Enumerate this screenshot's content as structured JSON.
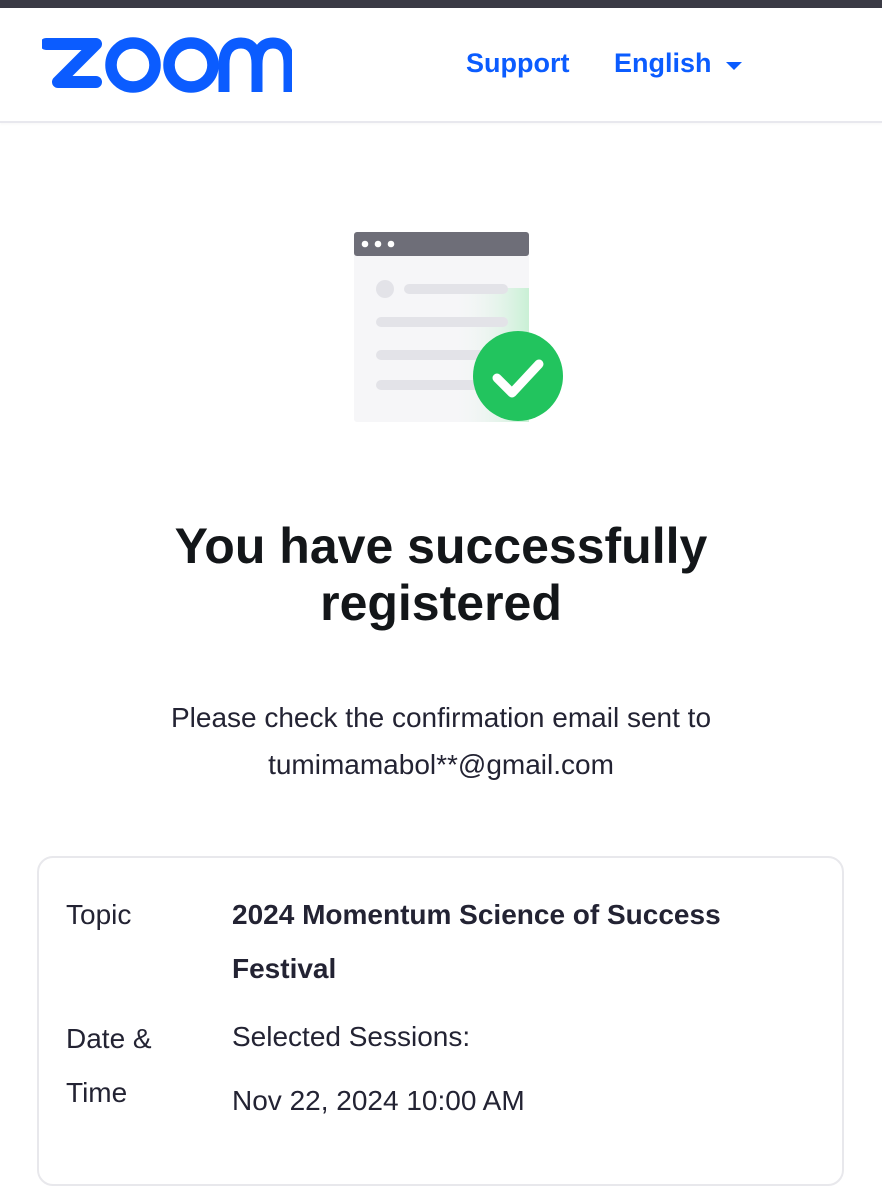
{
  "header": {
    "logo_text": "zoom",
    "support_label": "Support",
    "language_label": "English"
  },
  "colors": {
    "brand": "#0b5cff",
    "success": "#22c45e",
    "topbar": "#3a3a45"
  },
  "icons": {
    "illustration": "registration-success-illustration",
    "check": "check-icon",
    "caret": "chevron-down-icon"
  },
  "main": {
    "title": "You have successfully registered",
    "message_line1": "Please check the confirmation email sent to",
    "email": "tumimamabol**@gmail.com"
  },
  "details": {
    "topic_label": "Topic",
    "topic_value": "2024 Momentum Science of Success Festival",
    "datetime_label": "Date & Time",
    "sessions_label": "Selected Sessions:",
    "session_datetime": "Nov 22, 2024 10:00 AM"
  }
}
